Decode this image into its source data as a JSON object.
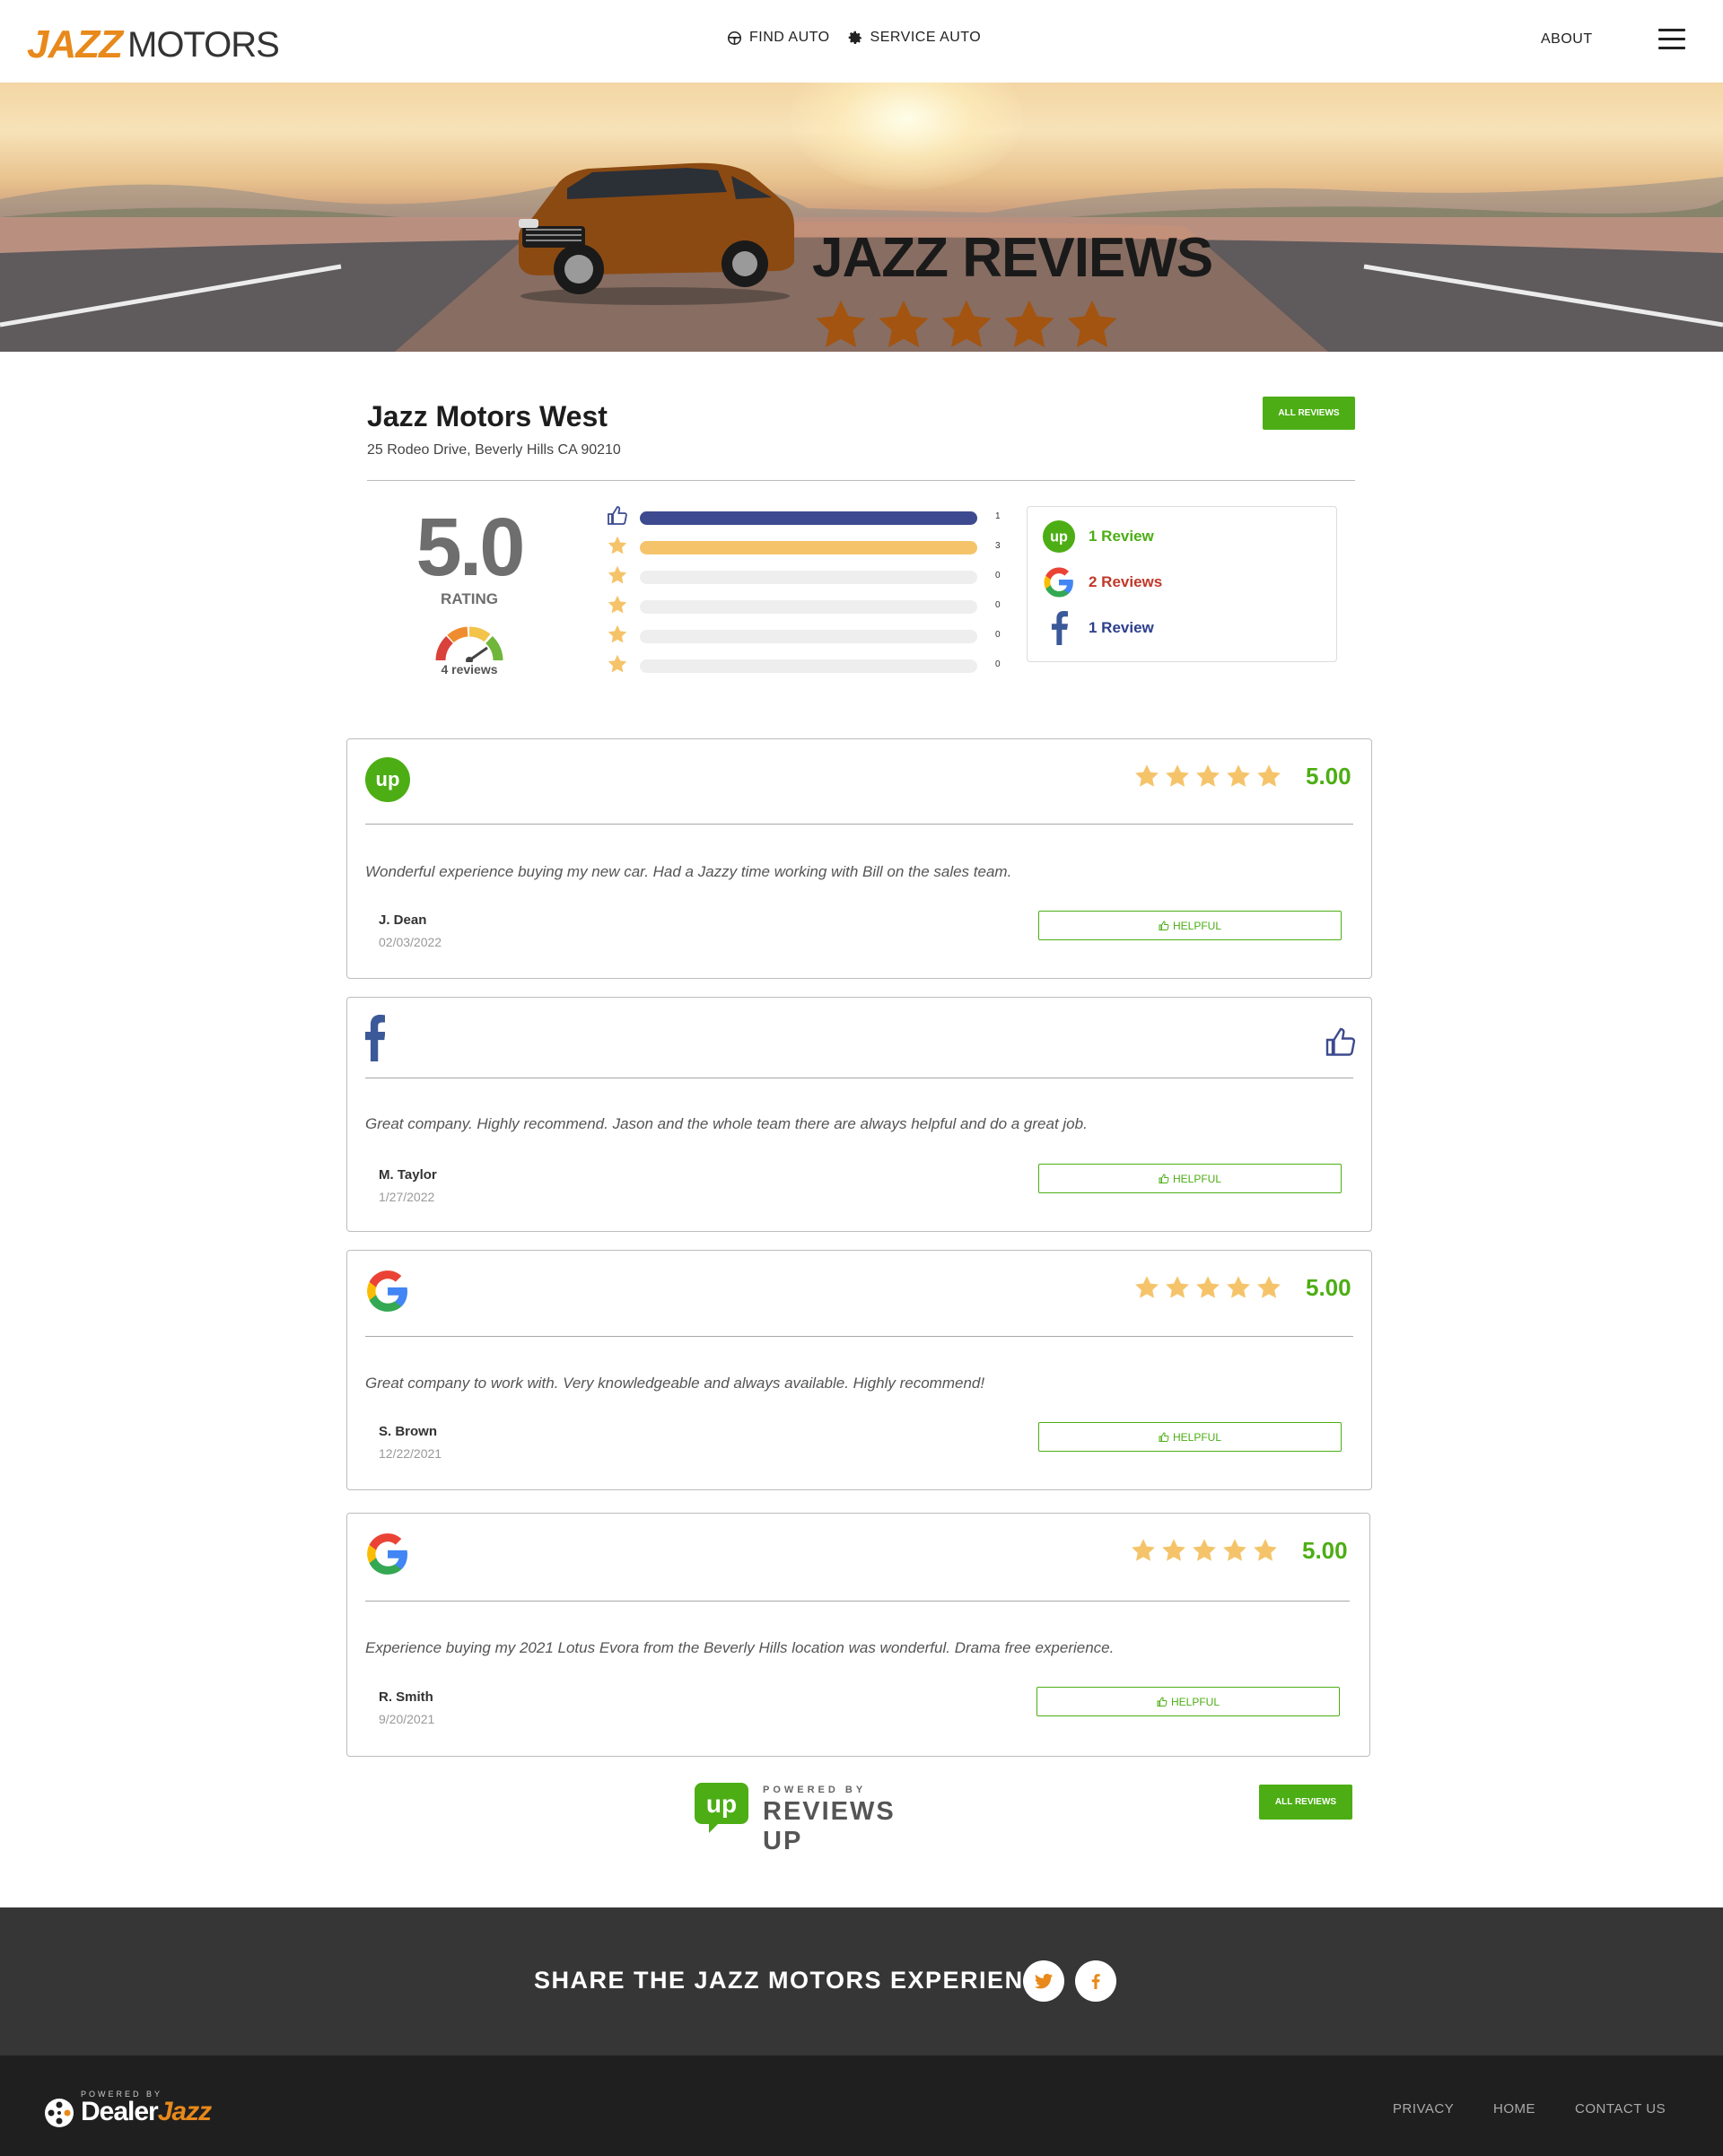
{
  "brand": {
    "logo_part1": "JAZZ",
    "logo_part2": "MOTORS",
    "accent": "#e8891b"
  },
  "nav": {
    "find_auto": "FIND AUTO",
    "service_auto": "SERVICE AUTO",
    "about": "ABOUT"
  },
  "hero": {
    "title": "JAZZ REVIEWS",
    "star_count": 5
  },
  "dealer": {
    "name": "Jazz Motors West",
    "address": "25 Rodeo Drive, Beverly Hills CA 90210",
    "all_reviews_label": "ALL REVIEWS"
  },
  "summary": {
    "rating": "5.0",
    "rating_label": "RATING",
    "reviews_count": "4 reviews",
    "distribution": [
      {
        "icon": "thumbs-up-icon",
        "count": "1",
        "fraction": 1.0,
        "color": "#3d4a8f"
      },
      {
        "icon": "star-5-icon",
        "count": "3",
        "fraction": 1.0,
        "color": "#f5c46a"
      },
      {
        "icon": "star-4-icon",
        "count": "0",
        "fraction": 0,
        "color": "#eeeeee"
      },
      {
        "icon": "star-3-icon",
        "count": "0",
        "fraction": 0,
        "color": "#eeeeee"
      },
      {
        "icon": "star-2-icon",
        "count": "0",
        "fraction": 0,
        "color": "#eeeeee"
      },
      {
        "icon": "star-1-icon",
        "count": "0",
        "fraction": 0,
        "color": "#eeeeee"
      }
    ],
    "sources": [
      {
        "name": "reviews-up",
        "label": "1 Review",
        "color": "#4cae14"
      },
      {
        "name": "google",
        "label": "2 Reviews",
        "color": "#c0392b"
      },
      {
        "name": "facebook",
        "label": "1 Review",
        "color": "#2d3f8c"
      }
    ]
  },
  "reviews": [
    {
      "source": "reviews-up",
      "score": "5.00",
      "text": "Wonderful experience buying my new car. Had a Jazzy time working with Bill on the sales team.",
      "author": "J. Dean",
      "date": "02/03/2022",
      "helpful_label": "HELPFUL"
    },
    {
      "source": "facebook",
      "score": "",
      "text": "Great company. Highly recommend. Jason and the whole team there are always helpful and do a great job.",
      "author": "M. Taylor",
      "date": "1/27/2022",
      "helpful_label": "HELPFUL"
    },
    {
      "source": "google",
      "score": "5.00",
      "text": "Great company to work with. Very knowledgeable and always available. Highly recommend!",
      "author": "S. Brown",
      "date": "12/22/2021",
      "helpful_label": "HELPFUL"
    },
    {
      "source": "google",
      "score": "5.00",
      "text": "Experience buying my 2021 Lotus Evora from the Beverly Hills location was wonderful. Drama free experience.",
      "author": "R. Smith",
      "date": "9/20/2021",
      "helpful_label": "HELPFUL"
    }
  ],
  "powered_by": {
    "label": "POWERED BY",
    "name": "REVIEWS UP",
    "all_reviews_label": "ALL REVIEWS"
  },
  "share": {
    "title": "SHARE THE JAZZ MOTORS EXPERIENCE"
  },
  "footer": {
    "powered_by": "POWERED BY",
    "dealer_part1": "Dealer",
    "dealer_part2": "Jazz",
    "links": [
      "PRIVACY",
      "HOME",
      "CONTACT US"
    ]
  },
  "colors": {
    "green": "#4cae14",
    "star": "#f5c46a",
    "facebook": "#3b5998",
    "footer_bg": "#1f1f1f",
    "share_bg": "#363636"
  }
}
